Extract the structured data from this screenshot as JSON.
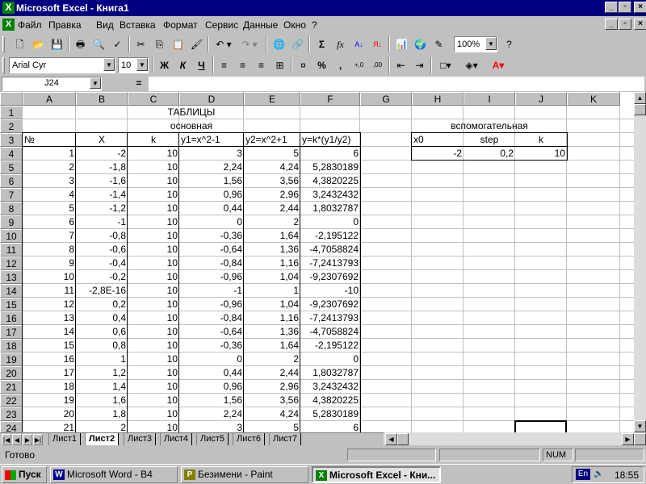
{
  "window": {
    "title": "Microsoft Excel - Книга1",
    "app_icon": "X"
  },
  "menu": [
    "Файл",
    "Правка",
    "Вид",
    "Вставка",
    "Формат",
    "Сервис",
    "Данные",
    "Окно",
    "?"
  ],
  "toolbar": {
    "zoom": "100%",
    "font_name": "Arial Cyr",
    "font_size": "10",
    "bold": "Ж",
    "italic": "К",
    "underline": "Ч",
    "percent": "%",
    "comma": ",",
    "sigma": "Σ",
    "fx": "fx"
  },
  "formula_bar": {
    "name_box": "J24",
    "equals": "=",
    "formula": ""
  },
  "columns": [
    "A",
    "B",
    "C",
    "D",
    "E",
    "F",
    "G",
    "H",
    "I",
    "J",
    "K"
  ],
  "rows": [
    "1",
    "2",
    "3",
    "4",
    "5",
    "6",
    "7",
    "8",
    "9",
    "10",
    "11",
    "12",
    "13",
    "14",
    "15",
    "16",
    "17",
    "18",
    "19",
    "20",
    "21",
    "22",
    "23",
    "24"
  ],
  "sheet": {
    "title": "ТАБЛИЦЫ",
    "main_label": "основная",
    "aux_label": "вспомогательная",
    "main_headers": [
      "№",
      "X",
      "k",
      "y1=x^2-1",
      "y2=x^2+1",
      "y=k*(y1/y2)"
    ],
    "aux_headers": [
      "x0",
      "step",
      "k"
    ],
    "aux_values": [
      "-2",
      "0,2",
      "10"
    ],
    "data": [
      [
        "1",
        "-2",
        "10",
        "3",
        "5",
        "6"
      ],
      [
        "2",
        "-1,8",
        "10",
        "2,24",
        "4,24",
        "5,2830189"
      ],
      [
        "3",
        "-1,6",
        "10",
        "1,56",
        "3,56",
        "4,3820225"
      ],
      [
        "4",
        "-1,4",
        "10",
        "0,96",
        "2,96",
        "3,2432432"
      ],
      [
        "5",
        "-1,2",
        "10",
        "0,44",
        "2,44",
        "1,8032787"
      ],
      [
        "6",
        "-1",
        "10",
        "0",
        "2",
        "0"
      ],
      [
        "7",
        "-0,8",
        "10",
        "-0,36",
        "1,64",
        "-2,195122"
      ],
      [
        "8",
        "-0,6",
        "10",
        "-0,64",
        "1,36",
        "-4,7058824"
      ],
      [
        "9",
        "-0,4",
        "10",
        "-0,84",
        "1,16",
        "-7,2413793"
      ],
      [
        "10",
        "-0,2",
        "10",
        "-0,96",
        "1,04",
        "-9,2307692"
      ],
      [
        "11",
        "-2,8E-16",
        "10",
        "-1",
        "1",
        "-10"
      ],
      [
        "12",
        "0,2",
        "10",
        "-0,96",
        "1,04",
        "-9,2307692"
      ],
      [
        "13",
        "0,4",
        "10",
        "-0,84",
        "1,16",
        "-7,2413793"
      ],
      [
        "14",
        "0,6",
        "10",
        "-0,64",
        "1,36",
        "-4,7058824"
      ],
      [
        "15",
        "0,8",
        "10",
        "-0,36",
        "1,64",
        "-2,195122"
      ],
      [
        "16",
        "1",
        "10",
        "0",
        "2",
        "0"
      ],
      [
        "17",
        "1,2",
        "10",
        "0,44",
        "2,44",
        "1,8032787"
      ],
      [
        "18",
        "1,4",
        "10",
        "0,96",
        "2,96",
        "3,2432432"
      ],
      [
        "19",
        "1,6",
        "10",
        "1,56",
        "3,56",
        "4,3820225"
      ],
      [
        "20",
        "1,8",
        "10",
        "2,24",
        "4,24",
        "5,2830189"
      ],
      [
        "21",
        "2",
        "10",
        "3",
        "5",
        "6"
      ]
    ]
  },
  "sheet_tabs": [
    "Лист1",
    "Лист2",
    "Лист3",
    "Лист4",
    "Лист5",
    "Лист6",
    "Лист7"
  ],
  "active_tab": "Лист2",
  "status": {
    "text": "Готово",
    "num": "NUM"
  },
  "taskbar": {
    "start": "Пуск",
    "tasks": [
      "Microsoft Word - B4",
      "Безимени - Paint",
      "Microsoft Excel - Кни..."
    ],
    "lang": "En",
    "clock": "18:55"
  }
}
